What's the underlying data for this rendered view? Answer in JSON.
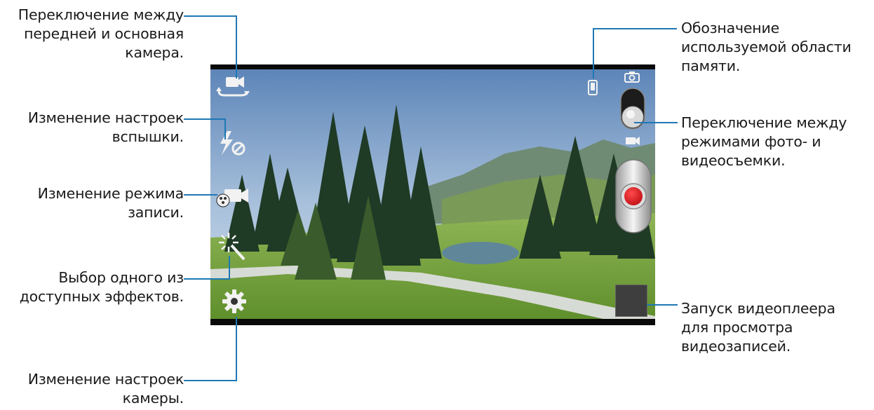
{
  "annotations": {
    "switch_camera": "Переключение между\nпередней и основная\nкамера.",
    "flash": "Изменение настроек\nвспышки.",
    "recording_mode": "Изменение режима\nзаписи.",
    "effects": "Выбор одного из\nдоступных эффектов.",
    "camera_settings": "Изменение настроек\nкамеры.",
    "storage": "Обозначение\nиспользуемой области\nпамяти.",
    "photo_video_switch": "Переключение между\nрежимами фото- и\nвидеосъемки.",
    "video_player": "Запуск видеоплеера\nдля просмотра\nвидеозаписей."
  },
  "icons": {
    "switch_camera": "switch-camera-icon",
    "flash": "flash-off-icon",
    "recording_mode": "recording-mode-icon",
    "effects": "effects-wand-icon",
    "settings": "gear-icon",
    "storage": "phone-storage-icon",
    "photo_mode": "camera-icon",
    "video_mode": "video-camera-icon",
    "record": "record-button",
    "thumbnail": "video-thumbnail"
  },
  "colors": {
    "callout_line": "#1f78b4",
    "record_button": "#d71920"
  }
}
